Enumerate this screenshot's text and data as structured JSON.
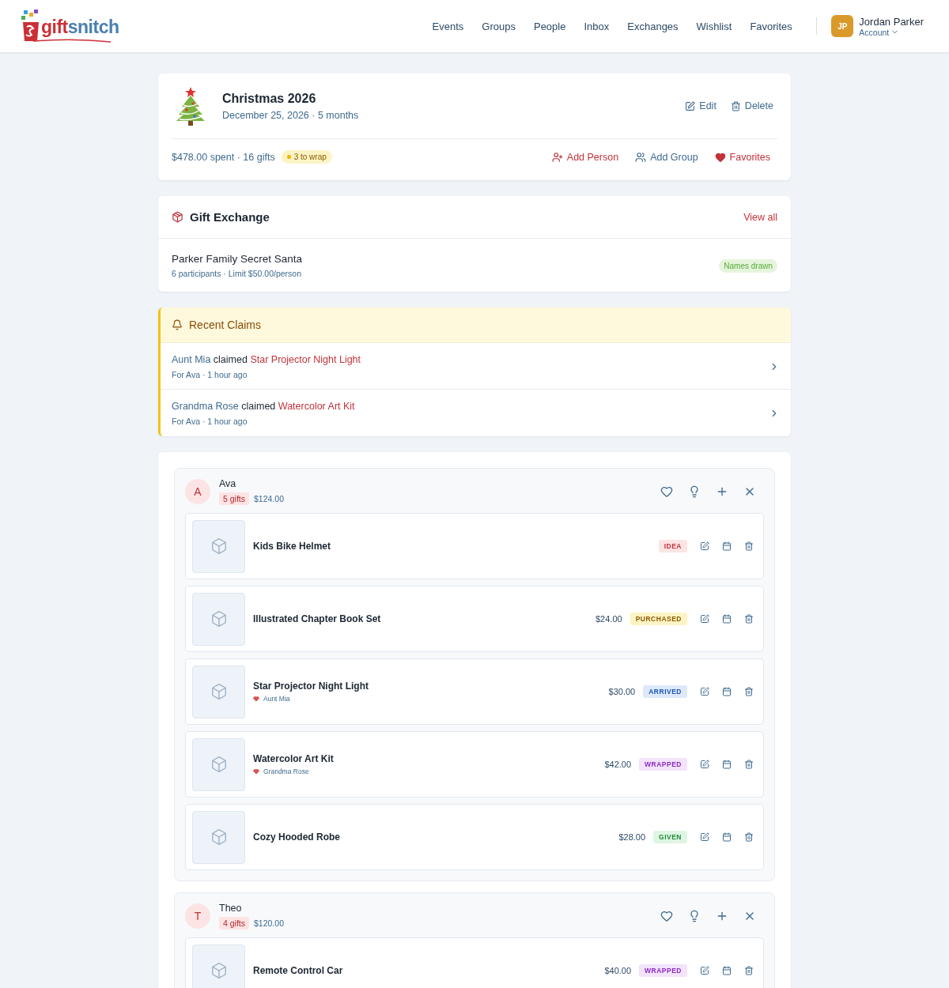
{
  "logo": {
    "prefix": "gift",
    "suffix": "snitch"
  },
  "nav": [
    "Events",
    "Groups",
    "People",
    "Inbox",
    "Exchanges",
    "Wishlist",
    "Favorites"
  ],
  "user": {
    "initials": "JP",
    "name": "Jordan Parker",
    "sub": "Account"
  },
  "event": {
    "title": "Christmas 2026",
    "subtitle": "December 25, 2026 · 5 months",
    "actions": [
      {
        "kind": "edit",
        "label": "Edit"
      },
      {
        "kind": "delete",
        "label": "Delete"
      }
    ],
    "summary": "$478.00 spent · 16 gifts",
    "wrap_badge": "3 to wrap",
    "links": [
      {
        "kind": "add-person",
        "label": "Add Person"
      },
      {
        "kind": "add-group",
        "label": "Add Group"
      },
      {
        "kind": "favorites",
        "label": "Favorites"
      }
    ]
  },
  "exchange": {
    "title": "Gift Exchange",
    "view_all": "View all",
    "name": "Parker Family Secret Santa",
    "details": "6 participants · Limit $50.00/person",
    "status": "Names drawn"
  },
  "claims": {
    "title": "Recent Claims",
    "items": [
      {
        "claimer": "Aunt Mia",
        "action": "claimed",
        "item": "Star Projector Night Light",
        "meta": "For Ava · 1 hour ago"
      },
      {
        "claimer": "Grandma Rose",
        "action": "claimed",
        "item": "Watercolor Art Kit",
        "meta": "For Ava · 1 hour ago"
      }
    ]
  },
  "people": [
    {
      "initial": "A",
      "name": "Ava",
      "count": "5 gifts",
      "total": "$124.00",
      "gifts": [
        {
          "name": "Kids Bike Helmet",
          "kind": "idea",
          "status": "IDEA"
        },
        {
          "name": "Illustrated Chapter Book Set",
          "price": "$24.00",
          "kind": "purchased",
          "status": "PURCHASED"
        },
        {
          "name": "Star Projector Night Light",
          "claimed_by": "Aunt Mia",
          "price": "$30.00",
          "kind": "arrived",
          "status": "ARRIVED"
        },
        {
          "name": "Watercolor Art Kit",
          "claimed_by": "Grandma Rose",
          "price": "$42.00",
          "kind": "wrapped",
          "status": "WRAPPED"
        },
        {
          "name": "Cozy Hooded Robe",
          "price": "$28.00",
          "kind": "given",
          "status": "GIVEN"
        }
      ]
    },
    {
      "initial": "T",
      "name": "Theo",
      "count": "4 gifts",
      "total": "$120.00",
      "gifts": [
        {
          "name": "Remote Control Car",
          "price": "$40.00",
          "kind": "wrapped",
          "status": "WRAPPED"
        }
      ]
    }
  ]
}
